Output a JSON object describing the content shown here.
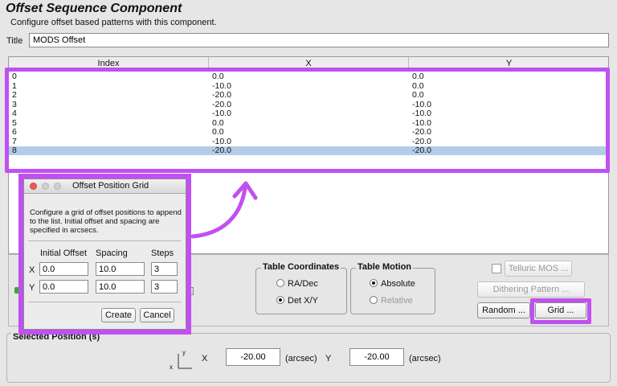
{
  "header": {
    "title": "Offset Sequence Component",
    "subtitle": "Configure offset based patterns with this component."
  },
  "title_field": {
    "label": "Title",
    "value": "MODS Offset"
  },
  "table": {
    "columns": [
      "Index",
      "X",
      "Y"
    ],
    "rows": [
      [
        "0",
        "0.0",
        "0.0"
      ],
      [
        "1",
        "-10.0",
        "0.0"
      ],
      [
        "2",
        "-20.0",
        "0.0"
      ],
      [
        "3",
        "-20.0",
        "-10.0"
      ],
      [
        "4",
        "-10.0",
        "-10.0"
      ],
      [
        "5",
        "0.0",
        "-10.0"
      ],
      [
        "6",
        "0.0",
        "-20.0"
      ],
      [
        "7",
        "-10.0",
        "-20.0"
      ],
      [
        "8",
        "-20.0",
        "-20.0"
      ]
    ],
    "selected_row": 8
  },
  "table_coordinates": {
    "title": "Table Coordinates",
    "options": [
      "RA/Dec",
      "Det X/Y"
    ],
    "selected": "Det X/Y"
  },
  "table_motion": {
    "title": "Table Motion",
    "options": [
      "Absolute",
      "Relative"
    ],
    "selected": "Absolute"
  },
  "buttons": {
    "telluric": "Telluric MOS ...",
    "dithering": "Dithering Pattern ...",
    "random": "Random ...",
    "grid": "Grid ..."
  },
  "selected_position": {
    "title": "Selected Position (s)",
    "x_label": "X",
    "x_value": "-20.00",
    "y_label": "Y",
    "y_value": "-20.00",
    "unit": "(arcsec)",
    "axis_x": "x",
    "axis_y": "y"
  },
  "dialog": {
    "title": "Offset Position Grid",
    "description": "Configure a grid of offset positions to append to the list. Initial offset and spacing are specified in arcsecs.",
    "col_headers": [
      "Initial Offset",
      "Spacing",
      "Steps"
    ],
    "row_x": {
      "label": "X",
      "initial": "0.0",
      "spacing": "10.0",
      "steps": "3"
    },
    "row_y": {
      "label": "Y",
      "initial": "0.0",
      "spacing": "10.0",
      "steps": "3"
    },
    "create": "Create",
    "cancel": "Cancel"
  },
  "colors": {
    "highlight": "#c050f0",
    "selection": "#b3cde8"
  }
}
